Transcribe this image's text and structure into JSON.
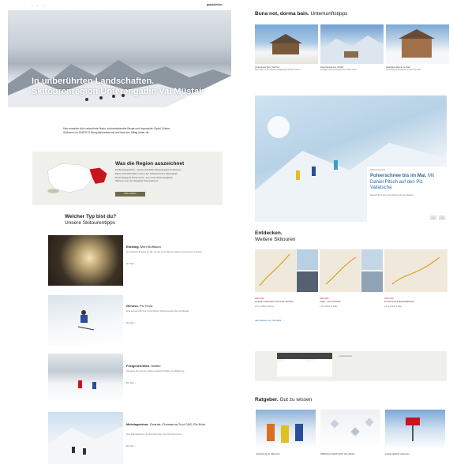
{
  "nav": {
    "dots": [
      "•",
      "•",
      "•"
    ],
    "logo": "graubünden"
  },
  "hero": {
    "title": "In unberührten Landschaften. Skitourenregion Unterengadin Val Müstair"
  },
  "intro": {
    "text": "Hier erwarten dich unberührte Natur, schneebedeckte Berge und imposante Gipfel. Erlebe Skitouren im UNESCO-Biosphärenreservat und lass den Alltag hinter dir."
  },
  "region": {
    "title": "Was die Region auszeichnet",
    "bullets": [
      "Die Bergsteigerdörfer – sind ein wahrhaftes Winterparadies für Skitouren",
      "Erlebe unberührte Natur rund um den Schweizerischen Nationalpark",
      "Mit der Bergsport-Schule Scuol – dem ersten Wintersportgebiet",
      "Skitouren unter dem Engadiner Sternenhimmel"
    ],
    "button": "Mehr erfahren"
  },
  "types": {
    "heading_bold": "Welcher Typ bist du?",
    "heading_sub": "Unsere Skitourentipps",
    "items": [
      {
        "title_bold": "Einstieg.",
        "title": "Mont Buffalora",
        "desc": "Ein einfacher Einstieg für alle, die das erste Mal eine Skitour unternehmen möchten.",
        "link": "Zur Tour →"
      },
      {
        "title_bold": "Genuss.",
        "title": "Piz Terza",
        "desc": "Eine genussvolle Tour mit herrlichem Panorama über das Val Müstair.",
        "link": "Zur Tour →"
      },
      {
        "title_bold": "Fortgeschritten.",
        "title": "Muttler",
        "desc": "Die lange Tour auf den Muttler verlangt Kondition und Erfahrung.",
        "link": "Zur Tour →"
      },
      {
        "title_bold": "Mehrtagestour.",
        "title": "Guarda–Chamanna Tuoi CAS–Piz Buin",
        "desc": "Eine Mehrtagestour mit Übernachtung in der Chamanna Tuoi.",
        "link": "Zur Tour →"
      }
    ]
  },
  "accommodation": {
    "heading_bold": "Buna not, dorma bain.",
    "heading_sub": "Unterkunftstipps",
    "items": [
      {
        "name": "Chamanna Tuoi, Val Tuoi",
        "desc": "Die Hütte ist ein idealer Ausgangspunkt für Touren."
      },
      {
        "name": "Hotel Sesvenna, Scharl",
        "desc": "Ruhiges Hotel am Ende des Val S-charl."
      },
      {
        "name": "Gasthaus Alpina, S-charl",
        "desc": "Gemütliches Gasthaus im Dorf S-charl."
      }
    ]
  },
  "feature": {
    "label": "Skitourenportrait",
    "title_bold": "Pulverschnee bis im Mai.",
    "title": "Mit Daniel Pitsch auf den Piz Vallatscha",
    "desc": "Daniel Pitsch kennt die Region wie kein Zweiter.",
    "pager": [
      "‹",
      "›"
    ]
  },
  "tours": {
    "heading_bold": "Entdecken.",
    "heading_sub": "Weitere Skitouren",
    "items": [
      {
        "label": "SKITOUR",
        "name": "Guarda–Chamanna Tuoi CAS–Piz Buin",
        "tags": "● 4h  ● 1450m  ● Schwer"
      },
      {
        "label": "SKITOUR",
        "name": "Ardez – Piz Cotschen",
        "tags": "● 5h  ● 1650m  ● Mittel"
      },
      {
        "label": "SKITOUR",
        "name": "Piz Terza ab Fuldera/Valchava",
        "tags": "● 4h  ● 1300m  ● Mittel"
      }
    ],
    "more": "Alle Skitouren im Überblick →",
    "list": [
      "• Chasa Muzet"
    ]
  },
  "advice": {
    "heading_bold": "Ratgeber.",
    "heading_sub": "Gut zu wissen",
    "items": [
      {
        "name": "Ausrüstung für Skitouren"
      },
      {
        "name": "Wildtierfreundlich durch den Winter"
      },
      {
        "name": "Lawinengefahr erkennen"
      }
    ]
  },
  "colors": {
    "accent": "#2a6a9c",
    "region_red": "#c8141e",
    "button": "#6c6a4c"
  }
}
